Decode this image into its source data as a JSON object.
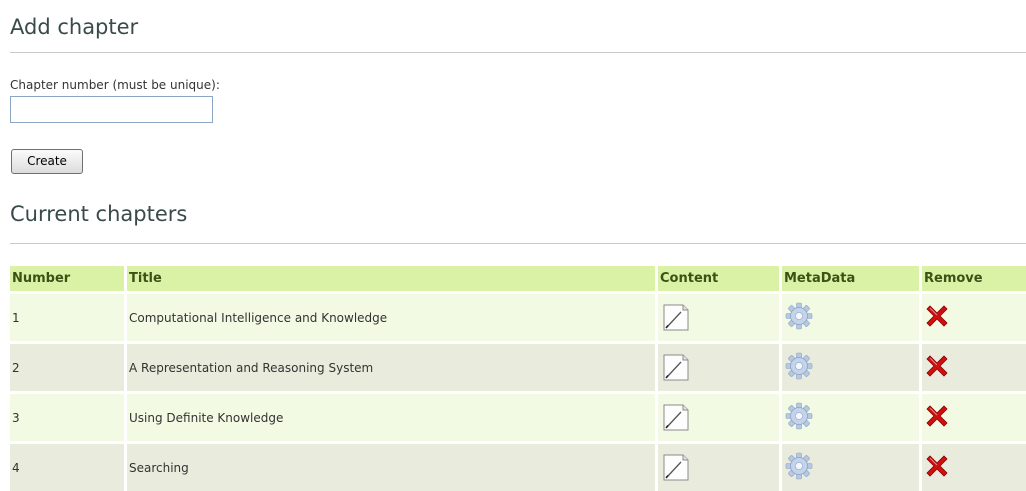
{
  "add_section": {
    "title": "Add chapter",
    "field_label": "Chapter number (must be unique):",
    "field_value": "",
    "create_label": "Create"
  },
  "current_section": {
    "title": "Current chapters"
  },
  "table": {
    "headers": [
      "Number",
      "Title",
      "Content",
      "MetaData",
      "Remove"
    ],
    "rows": [
      {
        "number": "1",
        "title": "Computational Intelligence and Knowledge"
      },
      {
        "number": "2",
        "title": "A Representation and Reasoning System"
      },
      {
        "number": "3",
        "title": "Using Definite Knowledge"
      },
      {
        "number": "4",
        "title": "Searching"
      }
    ],
    "icons": {
      "content": "edit-pencil-icon",
      "metadata": "gear-icon",
      "remove": "red-x-icon"
    },
    "colors": {
      "header_bg": "#d9f2a6",
      "row_odd": "#f3fae3",
      "row_even": "#e9ecdd",
      "remove_red": "#d01010"
    }
  }
}
